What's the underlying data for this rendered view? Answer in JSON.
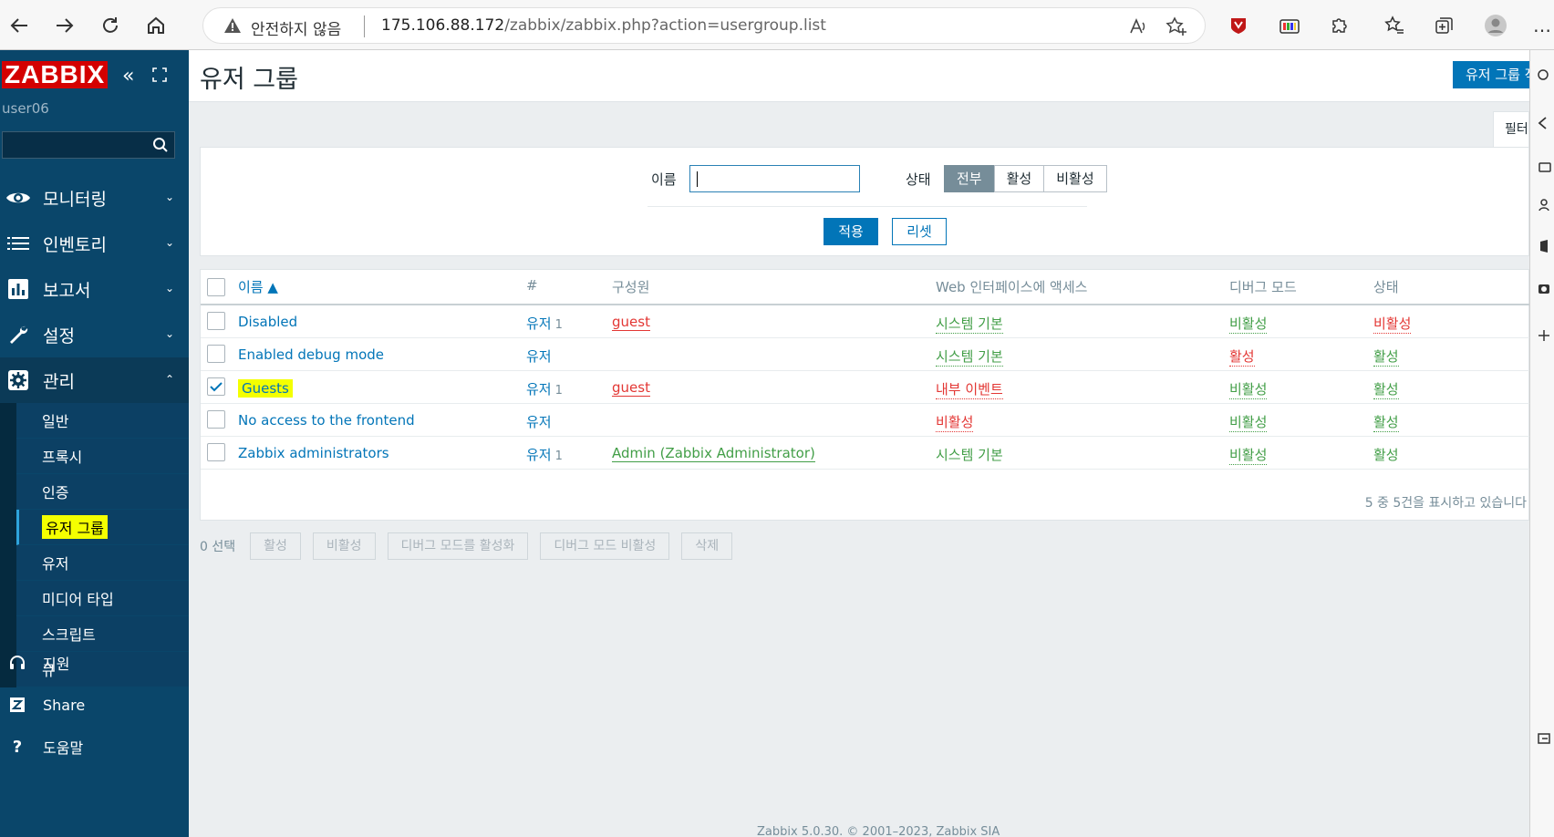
{
  "browser": {
    "insecure_label": "안전하지 않음",
    "url_host": "175.106.88.172",
    "url_path": "/zabbix/zabbix.php?action=usergroup.list"
  },
  "sidebar": {
    "logo": "ZABBIX",
    "collapse_glyph": "«",
    "username": "user06",
    "search_placeholder": "",
    "menu": [
      {
        "label": "모니터링",
        "icon": "eye-icon"
      },
      {
        "label": "인벤토리",
        "icon": "list-icon"
      },
      {
        "label": "보고서",
        "icon": "bar-chart-icon"
      },
      {
        "label": "설정",
        "icon": "wrench-icon"
      },
      {
        "label": "관리",
        "icon": "gear-icon"
      }
    ],
    "admin_submenu": [
      "일반",
      "프록시",
      "인증",
      "유저 그룹",
      "유저",
      "미디어 타입",
      "스크립트",
      "큐"
    ],
    "bottom": [
      {
        "label": "지원",
        "icon": "headset-icon"
      },
      {
        "label": "Share",
        "icon": "share-icon"
      },
      {
        "label": "도움말",
        "icon": "help-icon"
      }
    ]
  },
  "header": {
    "title": "유저 그룹",
    "create_button": "유저 그룹 작성"
  },
  "filter": {
    "tab_label": "필터",
    "name_label": "이름",
    "name_value": "",
    "status_label": "상태",
    "status_options": [
      "전부",
      "활성",
      "비활성"
    ],
    "status_selected": "전부",
    "apply": "적용",
    "reset": "리셋"
  },
  "table": {
    "headers": [
      "이름 ▲",
      "#",
      "구성원",
      "Web 인터페이스에 액세스",
      "디버그 모드",
      "상태"
    ],
    "rows": [
      {
        "name": "Disabled",
        "count_label": "유저",
        "count": "1",
        "members": "guest",
        "members_color": "red",
        "frontend": "시스템 기본",
        "frontend_color": "green",
        "debug": "비활성",
        "debug_color": "green",
        "status": "비활성",
        "status_color": "red",
        "checked": false
      },
      {
        "name": "Enabled debug mode",
        "count_label": "유저",
        "count": "",
        "members": "",
        "members_color": "",
        "frontend": "시스템 기본",
        "frontend_color": "green",
        "debug": "활성",
        "debug_color": "red",
        "status": "활성",
        "status_color": "green",
        "checked": false
      },
      {
        "name": "Guests",
        "count_label": "유저",
        "count": "1",
        "members": "guest",
        "members_color": "red",
        "frontend": "내부 이벤트",
        "frontend_color": "red",
        "debug": "비활성",
        "debug_color": "green",
        "status": "활성",
        "status_color": "green",
        "checked": true
      },
      {
        "name": "No access to the frontend",
        "count_label": "유저",
        "count": "",
        "members": "",
        "members_color": "",
        "frontend": "비활성",
        "frontend_color": "red",
        "debug": "비활성",
        "debug_color": "green",
        "status": "활성",
        "status_color": "green",
        "checked": false
      },
      {
        "name": "Zabbix administrators",
        "count_label": "유저",
        "count": "1",
        "members": "Admin (Zabbix Administrator)",
        "members_color": "green",
        "frontend": "시스템 기본",
        "frontend_color": "greenplain",
        "debug": "비활성",
        "debug_color": "green",
        "status": "활성",
        "status_color": "greenplain",
        "checked": false
      }
    ],
    "paging": "5 중 5건을 표시하고 있습니다"
  },
  "actions": {
    "selected": "0 선택",
    "buttons": [
      "활성",
      "비활성",
      "디버그 모드를 활성화",
      "디버그 모드 비활성",
      "삭제"
    ]
  },
  "footer": "Zabbix 5.0.30. © 2001–2023, Zabbix SIA",
  "colors": {
    "brand_red": "#d40000",
    "sidebar_blue": "#0a466a",
    "link_blue": "#0275b8",
    "ok_green": "#429e47",
    "bad_red": "#e33734"
  }
}
